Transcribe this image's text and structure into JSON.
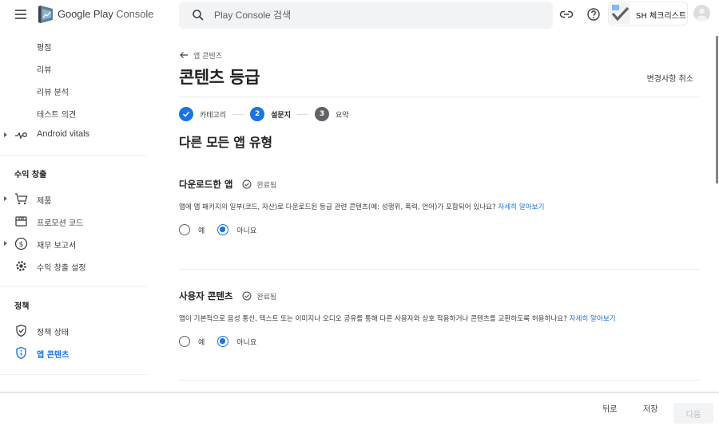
{
  "header": {
    "brand_primary": "Google Play",
    "brand_secondary": "Console",
    "search_placeholder": "Play Console 검색",
    "account_name": "SH 체크리스트",
    "icons": [
      "menu-icon",
      "play-console-logo",
      "search-icon",
      "link-icon",
      "help-icon",
      "app-icon",
      "avatar-icon"
    ]
  },
  "sidebar": {
    "items_top": [
      {
        "label": "평점"
      },
      {
        "label": "리뷰"
      },
      {
        "label": "리뷰 분석"
      },
      {
        "label": "테스트 의견"
      },
      {
        "label": "Android vitals",
        "icon": "vitals-icon",
        "expandable": true
      }
    ],
    "monetize_section": "수익 창출",
    "monetize_items": [
      {
        "label": "제품",
        "icon": "cart-icon",
        "expandable": true
      },
      {
        "label": "프로모션 코드",
        "icon": "store-icon"
      },
      {
        "label": "재무 보고서",
        "icon": "dollar-icon",
        "expandable": true
      },
      {
        "label": "수익 창출 설정",
        "icon": "gear-icon"
      }
    ],
    "policy_section": "정책",
    "policy_items": [
      {
        "label": "정책 상태",
        "icon": "shield-check-icon"
      },
      {
        "label": "앱 콘텐츠",
        "icon": "shield-info-icon",
        "active": true
      }
    ]
  },
  "main": {
    "breadcrumb": "앱 콘텐츠",
    "title": "콘텐츠 등급",
    "discard_label": "변경사항 취소",
    "steps": [
      {
        "number": "1",
        "label": "카테고리",
        "state": "done"
      },
      {
        "number": "2",
        "label": "설문지",
        "state": "current"
      },
      {
        "number": "3",
        "label": "요약",
        "state": "todo"
      }
    ],
    "section_title": "다른 모든 앱 유형",
    "questions": [
      {
        "title": "다운로드한 앱",
        "status": "완료됨",
        "text": "앱에 앱 패키지의 일부(코드, 자산)로 다운로드된 등급 관련 콘텐츠(예: 성행위, 폭력, 언어)가 포함되어 있나요?",
        "link": "자세히 알아보기",
        "options": [
          "예",
          "아니요"
        ],
        "selected": "아니요"
      },
      {
        "title": "사용자 콘텐츠",
        "status": "완료됨",
        "text": "앱이 기본적으로 음성 통신, 텍스트 또는 이미지나 오디오 공유를 통해 다른 사용자와 상호 작용하거나 콘텐츠를 교환하도록 허용하나요?",
        "link": "자세히 알아보기",
        "options": [
          "예",
          "아니요"
        ],
        "selected": "아니요"
      }
    ]
  },
  "footer": {
    "back_label": "뒤로",
    "save_label": "저장",
    "next_label": "다음",
    "next_disabled": true
  },
  "colors": {
    "accent": "#1a73e8",
    "text_primary": "#202124",
    "text_secondary": "#5f6368",
    "disabled_bg": "#f1f3f4",
    "step_todo": "#5f6368"
  }
}
